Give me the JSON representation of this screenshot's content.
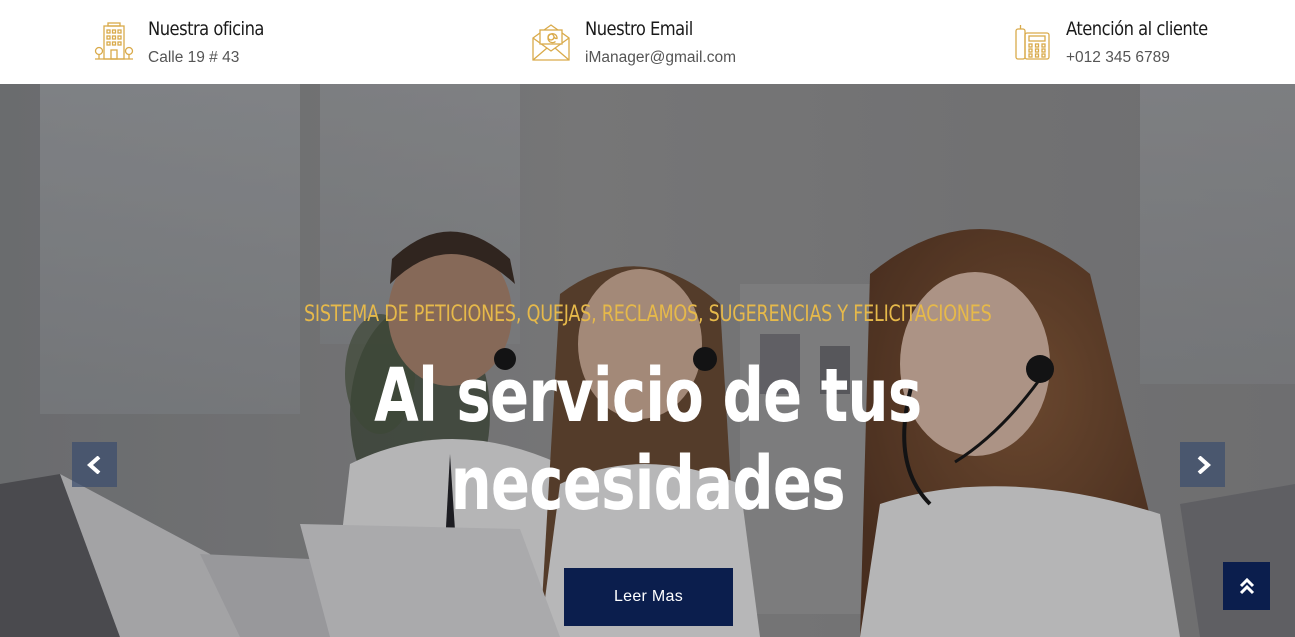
{
  "contact_bar": {
    "office": {
      "title": "Nuestra oficina",
      "value": "Calle 19 # 43",
      "icon": "building-icon"
    },
    "email": {
      "title": "Nuestro Email",
      "value": "iManager@gmail.com",
      "icon": "envelope-icon"
    },
    "support": {
      "title": "Atención al cliente",
      "value": "+012 345 6789",
      "icon": "phone-icon"
    }
  },
  "hero": {
    "kicker": "SISTEMA DE PETICIONES, QUEJAS, RECLAMOS, SUGERENCIAS Y FELICITACIONES",
    "headline_line1": "Al servicio de tus",
    "headline_line2": "necesidades",
    "cta_label": "Leer Mas",
    "prev_icon": "chevron-left-icon",
    "next_icon": "chevron-right-icon"
  },
  "back_to_top": {
    "icon": "double-chevron-up-icon"
  },
  "colors": {
    "accent_gold": "#e6b94a",
    "icon_gold": "#d9aa4a",
    "navy": "#0b1e4d",
    "heading_text": "#1a1a1a",
    "muted_text": "#555555"
  }
}
